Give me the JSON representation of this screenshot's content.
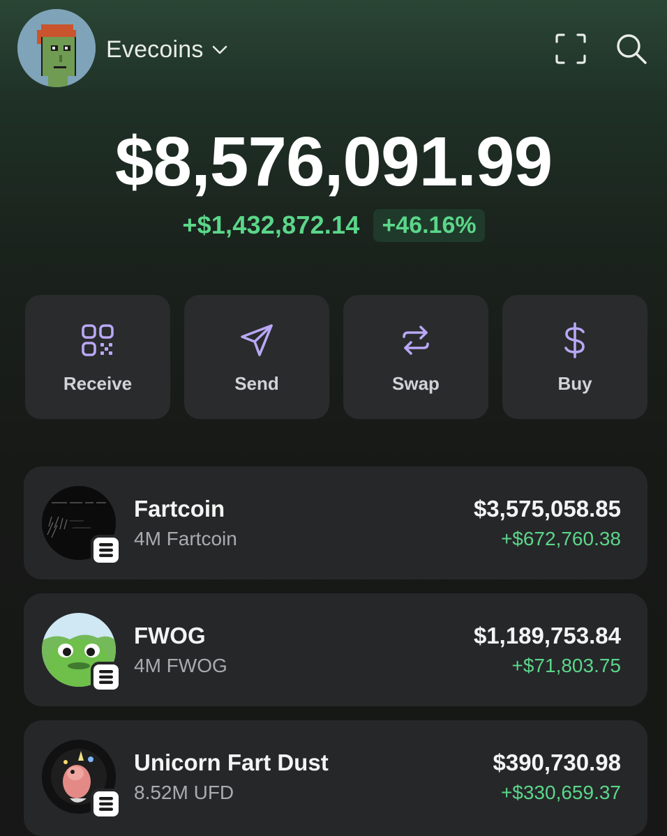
{
  "header": {
    "account_name": "Evecoins",
    "icons": [
      "avatar",
      "chevron-down-icon",
      "scan-icon",
      "search-icon"
    ]
  },
  "portfolio": {
    "balance": "$8,576,091.99",
    "change_amount": "+$1,432,872.14",
    "change_percent": "+46.16%"
  },
  "actions": [
    {
      "label": "Receive",
      "icon": "qr-code-icon"
    },
    {
      "label": "Send",
      "icon": "send-icon"
    },
    {
      "label": "Swap",
      "icon": "swap-icon"
    },
    {
      "label": "Buy",
      "icon": "dollar-icon"
    }
  ],
  "tokens": [
    {
      "name": "Fartcoin",
      "amount": "4M Fartcoin",
      "value": "$3,575,058.85",
      "change": "+$672,760.38"
    },
    {
      "name": "FWOG",
      "amount": "4M FWOG",
      "value": "$1,189,753.84",
      "change": "+$71,803.75"
    },
    {
      "name": "Unicorn Fart Dust",
      "amount": "8.52M UFD",
      "value": "$390,730.98",
      "change": "+$330,659.37"
    }
  ],
  "colors": {
    "accent_green": "#5bd68a",
    "action_icon": "#b9a8f5",
    "card_bg": "#262729"
  }
}
